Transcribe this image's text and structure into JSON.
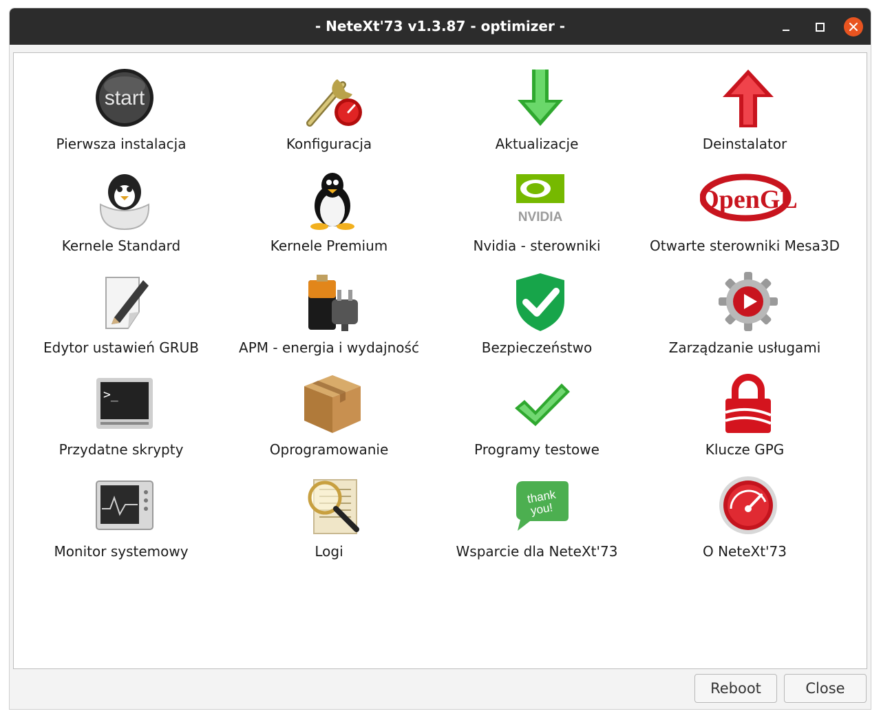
{
  "window": {
    "title": "- NeteXt'73 v1.3.87 - optimizer -"
  },
  "items": [
    {
      "label": "Pierwsza instalacja",
      "icon": "start-icon"
    },
    {
      "label": "Konfiguracja",
      "icon": "wrench-gauge-icon"
    },
    {
      "label": "Aktualizacje",
      "icon": "green-down-arrow-icon"
    },
    {
      "label": "Deinstalator",
      "icon": "red-up-arrow-icon"
    },
    {
      "label": "Kernele Standard",
      "icon": "penguin-egg-icon"
    },
    {
      "label": "Kernele Premium",
      "icon": "tux-penguin-icon"
    },
    {
      "label": "Nvidia - sterowniki",
      "icon": "nvidia-logo-icon",
      "logo_text": "NVIDIA"
    },
    {
      "label": "Otwarte sterowniki Mesa3D",
      "icon": "opengl-logo-icon",
      "logo_text": "OpenGL"
    },
    {
      "label": "Edytor ustawień GRUB",
      "icon": "edit-document-icon"
    },
    {
      "label": "APM - energia i wydajność",
      "icon": "battery-plug-icon"
    },
    {
      "label": "Bezpieczeństwo",
      "icon": "shield-check-icon"
    },
    {
      "label": "Zarządzanie usługami",
      "icon": "gear-play-icon"
    },
    {
      "label": "Przydatne skrypty",
      "icon": "terminal-icon",
      "logo_text": ">_"
    },
    {
      "label": "Oprogramowanie",
      "icon": "package-box-icon"
    },
    {
      "label": "Programy testowe",
      "icon": "green-checkmark-icon"
    },
    {
      "label": "Klucze GPG",
      "icon": "padlock-icon"
    },
    {
      "label": "Monitor systemowy",
      "icon": "system-monitor-icon"
    },
    {
      "label": "Logi",
      "icon": "magnifier-document-icon"
    },
    {
      "label": "Wsparcie dla NeteXt'73",
      "icon": "thank-you-bubble-icon",
      "logo_text": "thank you!"
    },
    {
      "label": "O NeteXt'73",
      "icon": "speedometer-icon"
    }
  ],
  "buttons": {
    "reboot": "Reboot",
    "close": "Close"
  },
  "colors": {
    "titlebar": "#2c2c2c",
    "close_button": "#e95420",
    "panel": "#ffffff"
  }
}
